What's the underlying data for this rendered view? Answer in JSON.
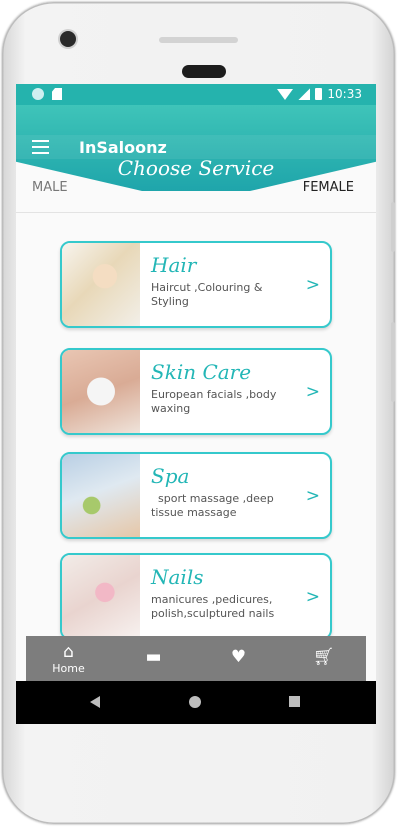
{
  "status_bar": {
    "time": "10:33"
  },
  "app_bar": {
    "title": "InSaloonz",
    "menu_icon": "hamburger-menu-icon"
  },
  "header": {
    "heading": "Choose Service"
  },
  "gender_tabs": {
    "male": "MALE",
    "female": "FEMALE",
    "selected": "FEMALE"
  },
  "services": [
    {
      "title": "Hair",
      "description": "Haircut ,Colouring & Styling",
      "arrow": ">"
    },
    {
      "title": "Skin Care",
      "description": "European facials ,body waxing",
      "arrow": ">"
    },
    {
      "title": "Spa",
      "description": "  sport massage ,deep tissue massage",
      "arrow": ">"
    },
    {
      "title": "Nails",
      "description": "manicures ,pedicures, polish,sculptured nails",
      "arrow": ">"
    }
  ],
  "bottom_nav": [
    {
      "label": "Home",
      "icon": "home-icon",
      "glyph": "⌂"
    },
    {
      "label": "",
      "icon": "ticket-icon",
      "glyph": "▬"
    },
    {
      "label": "",
      "icon": "heart-icon",
      "glyph": "♥"
    },
    {
      "label": "",
      "icon": "cart-icon",
      "glyph": "🛒︎"
    }
  ],
  "colors": {
    "accent": "#25b3ad",
    "nav_bg": "#7d7d7d",
    "card_border": "#35c9cc"
  }
}
